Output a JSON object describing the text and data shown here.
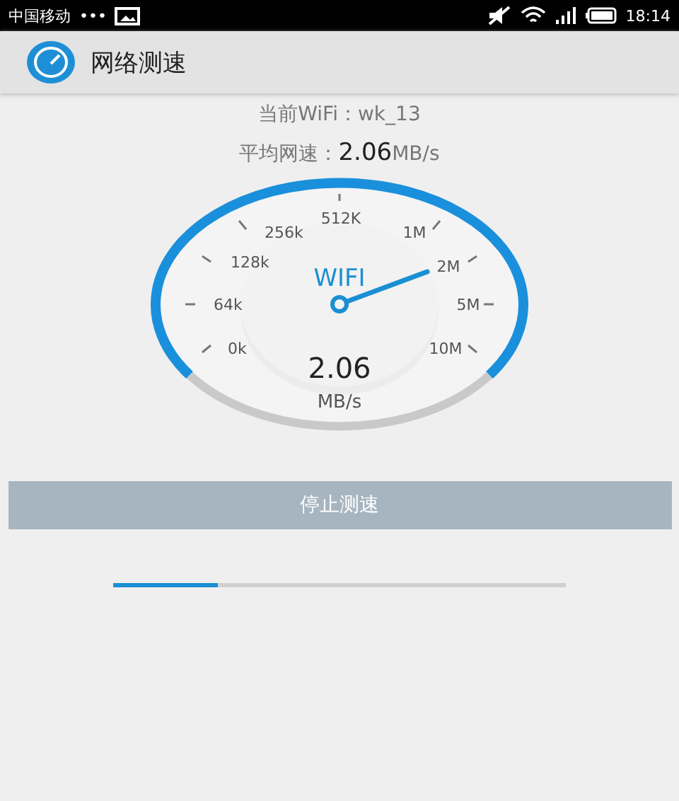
{
  "status_bar": {
    "carrier": "中国移动",
    "dots": "•••",
    "time": "18:14"
  },
  "app_bar": {
    "title": "网络测速"
  },
  "info": {
    "current_wifi": "当前WiFi：wk_13",
    "average_label": "平均网速：",
    "average_value": "2.06",
    "average_unit": "MB/s"
  },
  "gauge": {
    "label": "WIFI",
    "value": "2.06",
    "unit": "MB/s",
    "scale": [
      "512K",
      "256k",
      "1M",
      "128k",
      "2M",
      "64k",
      "5M",
      "0k",
      "10M"
    ]
  },
  "stop_button": {
    "label": "停止测速"
  },
  "progress": {
    "level": 0.23
  }
}
